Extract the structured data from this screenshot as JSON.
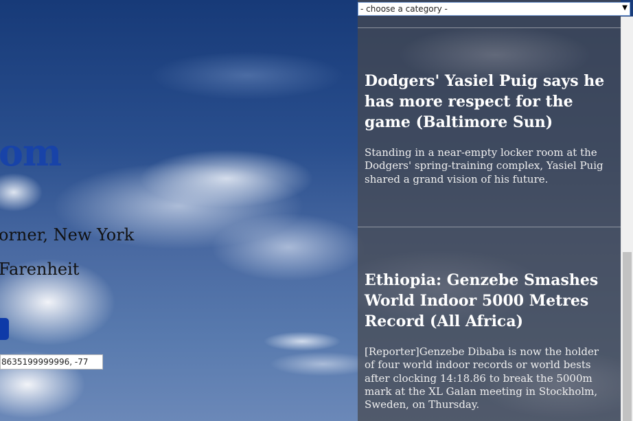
{
  "left": {
    "site_title": "om",
    "location": "orner, New York",
    "temperature": "Farenheit",
    "coordinates_value": "8635199999996, -77"
  },
  "category_select": {
    "selected": "- choose a category -",
    "arrow": "▼"
  },
  "articles": [
    {
      "title": "Dodgers' Yasiel Puig says he has more respect for the game (Baltimore Sun)",
      "summary": "Standing in a near-empty locker room at the Dodgers' spring-training complex, Yasiel Puig shared a grand vision of his future."
    },
    {
      "title": "Ethiopia: Genzebe Smashes World Indoor 5000 Metres Record (All Africa)",
      "summary": "[Reporter]Genzebe Dibaba is now the holder of four world indoor records or world bests after clocking 14:18.86 to break the 5000m mark at the XL Galan meeting in Stockholm, Sweden, on Thursday."
    }
  ],
  "colors": {
    "title_blue": "#1843a8",
    "button_blue": "#0e3aa8",
    "panel_overlay": "rgba(70,72,78,0.72)"
  }
}
